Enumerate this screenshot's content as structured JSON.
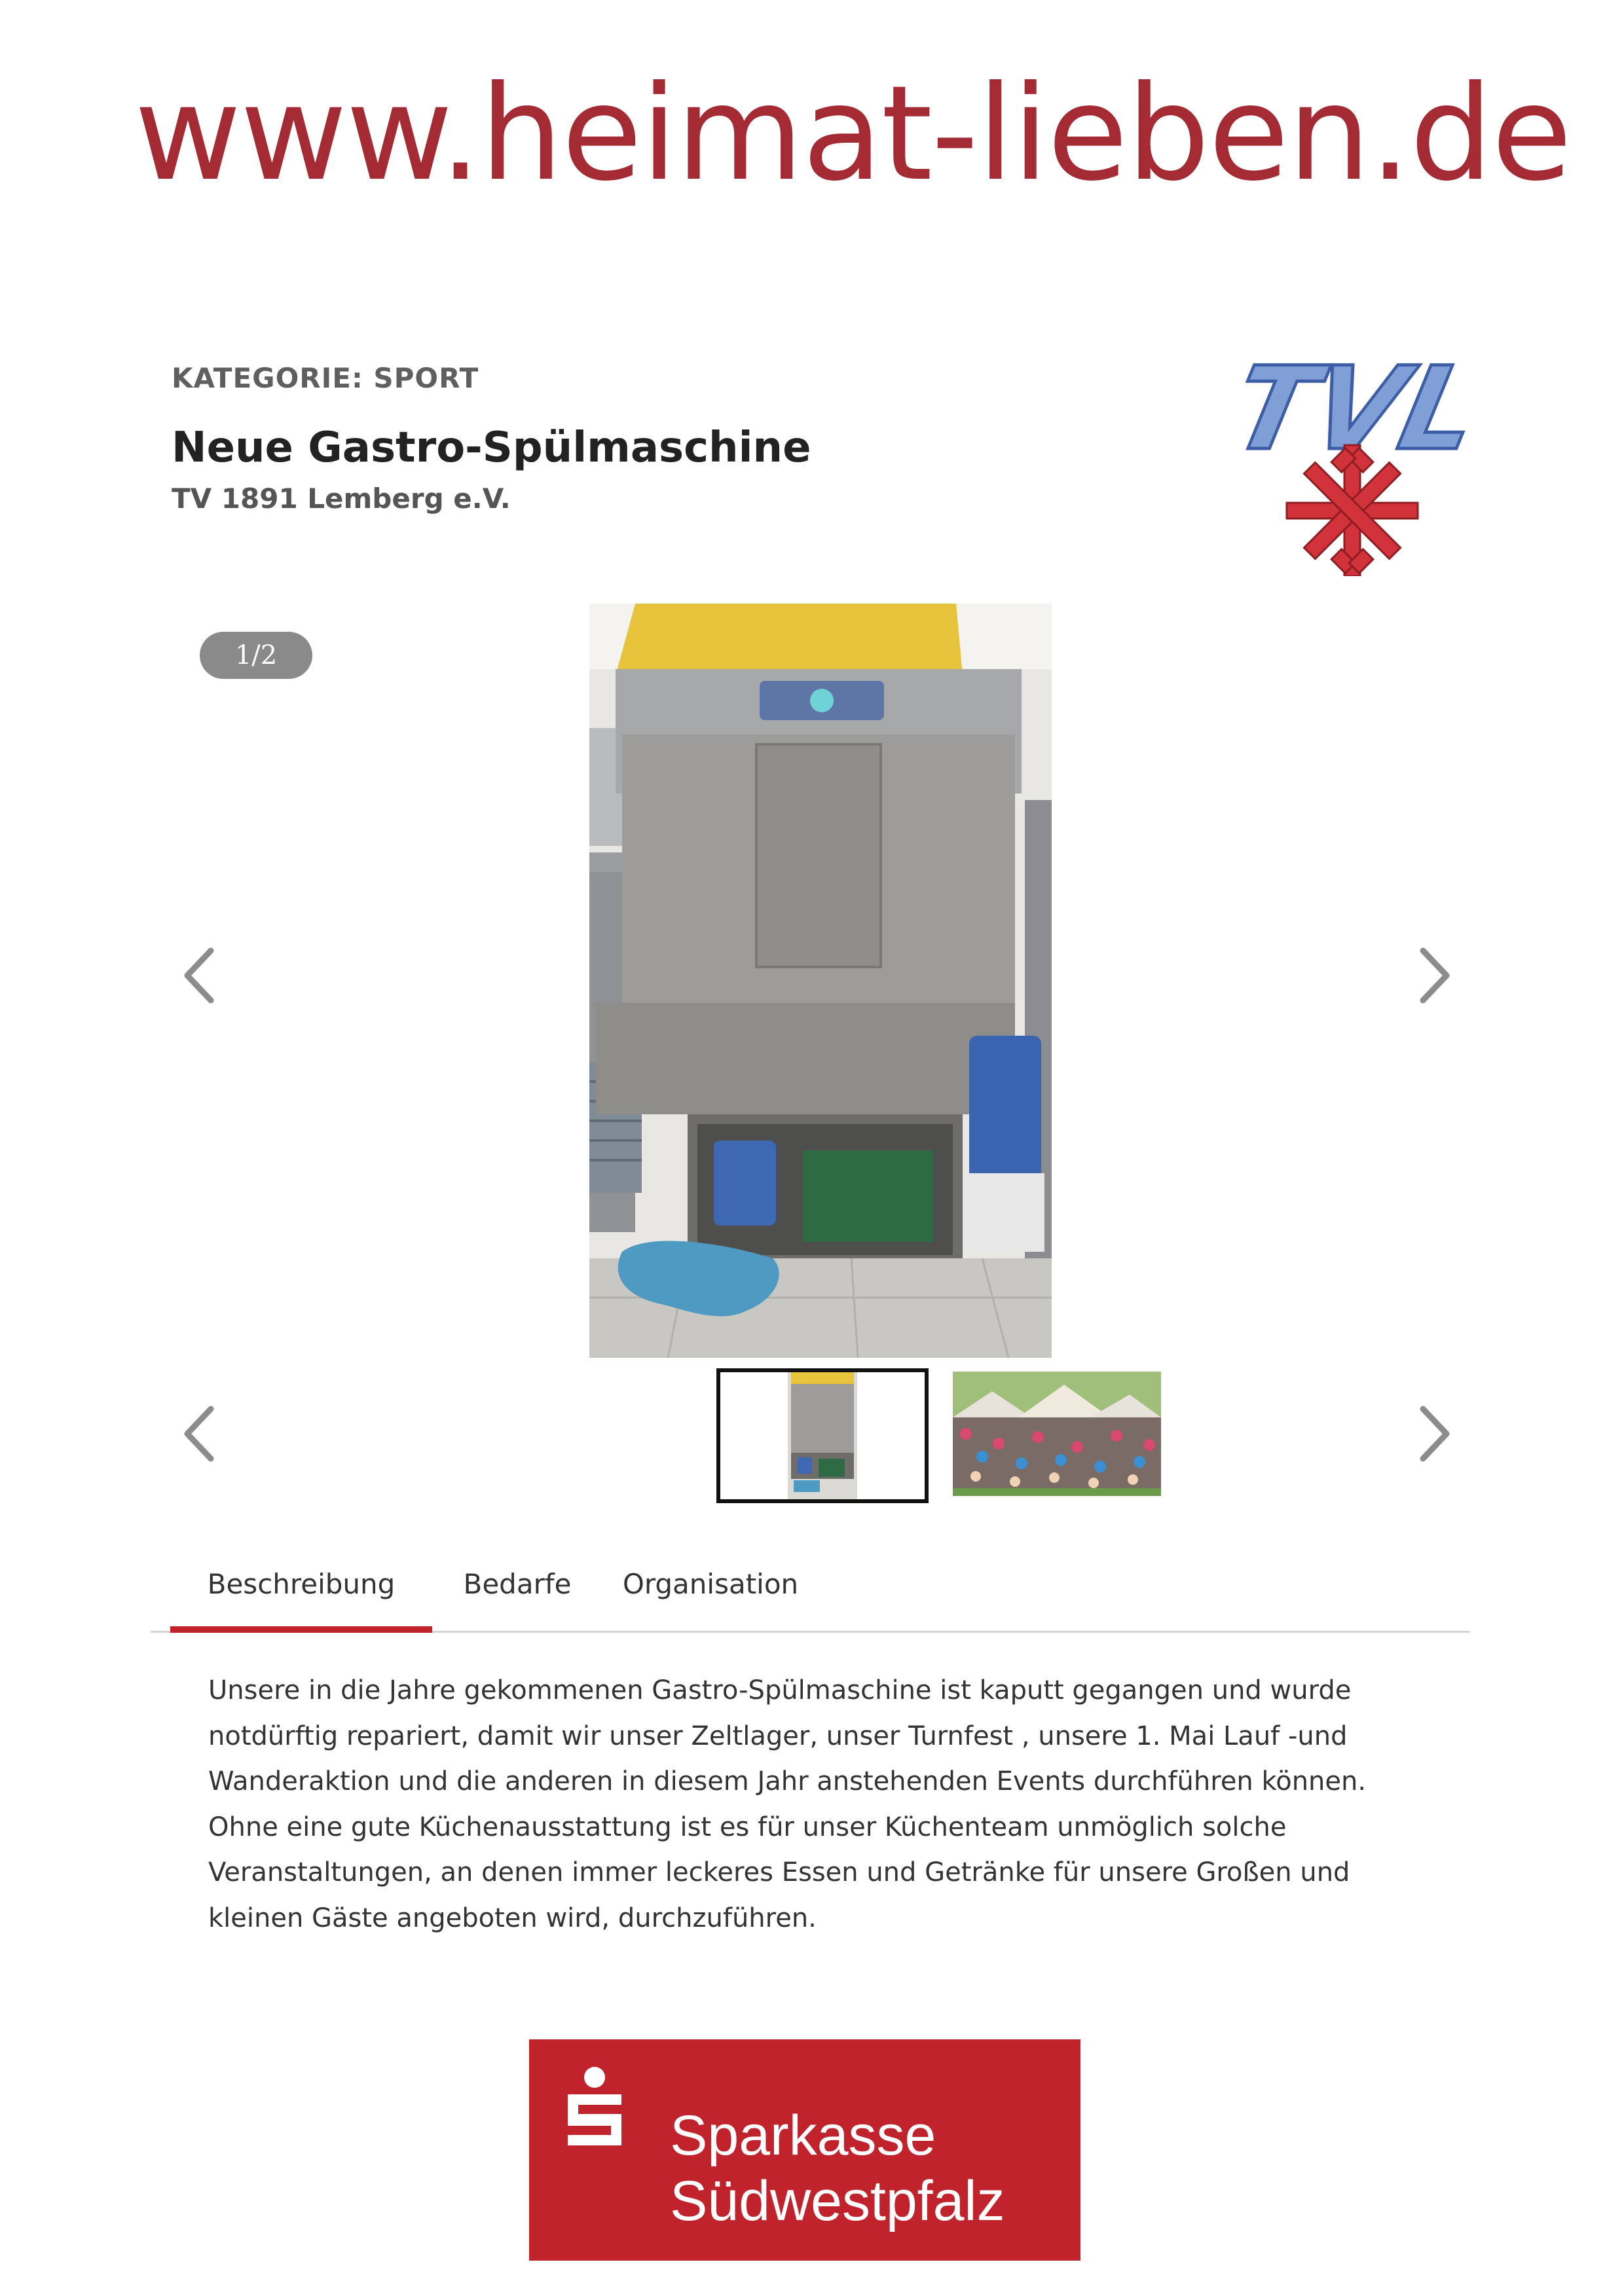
{
  "header": {
    "site_url": "www.heimat-lieben.de"
  },
  "project": {
    "category": "KATEGORIE: SPORT",
    "title": "Neue Gastro-Spülmaschine",
    "organization": "TV 1891 Lemberg e.V."
  },
  "club_logo": {
    "text": "TVL"
  },
  "gallery": {
    "counter": "1/2",
    "prev_icon": "chevron-left-icon",
    "next_icon": "chevron-right-icon",
    "active_thumbnail": 1,
    "thumbnail_count": 2
  },
  "tabs": [
    {
      "label": "Beschreibung",
      "active": true
    },
    {
      "label": "Bedarfe",
      "active": false
    },
    {
      "label": "Organisation",
      "active": false
    }
  ],
  "description": {
    "lines": [
      "Unsere in die Jahre gekommenen Gastro-Spülmaschine ist kaputt gegangen und wurde",
      "notdürftig repariert, damit wir unser Zeltlager, unser Turnfest , unsere 1. Mai Lauf -und",
      "Wanderaktion und die anderen in diesem Jahr anstehenden Events durchführen können.",
      "Ohne eine gute Küchenausstattung ist es für unser Küchenteam unmöglich solche",
      "Veranstaltungen, an denen immer leckeres Essen und Getränke für unsere Großen und",
      "kleinen Gäste angeboten wird, durchzuführen."
    ]
  },
  "sponsor": {
    "line1": "Sparkasse",
    "line2": "Südwestpfalz"
  },
  "colors": {
    "brand_red": "#c0232c",
    "url_red": "#a42a33",
    "counter_gray": "#8a8a8a"
  }
}
